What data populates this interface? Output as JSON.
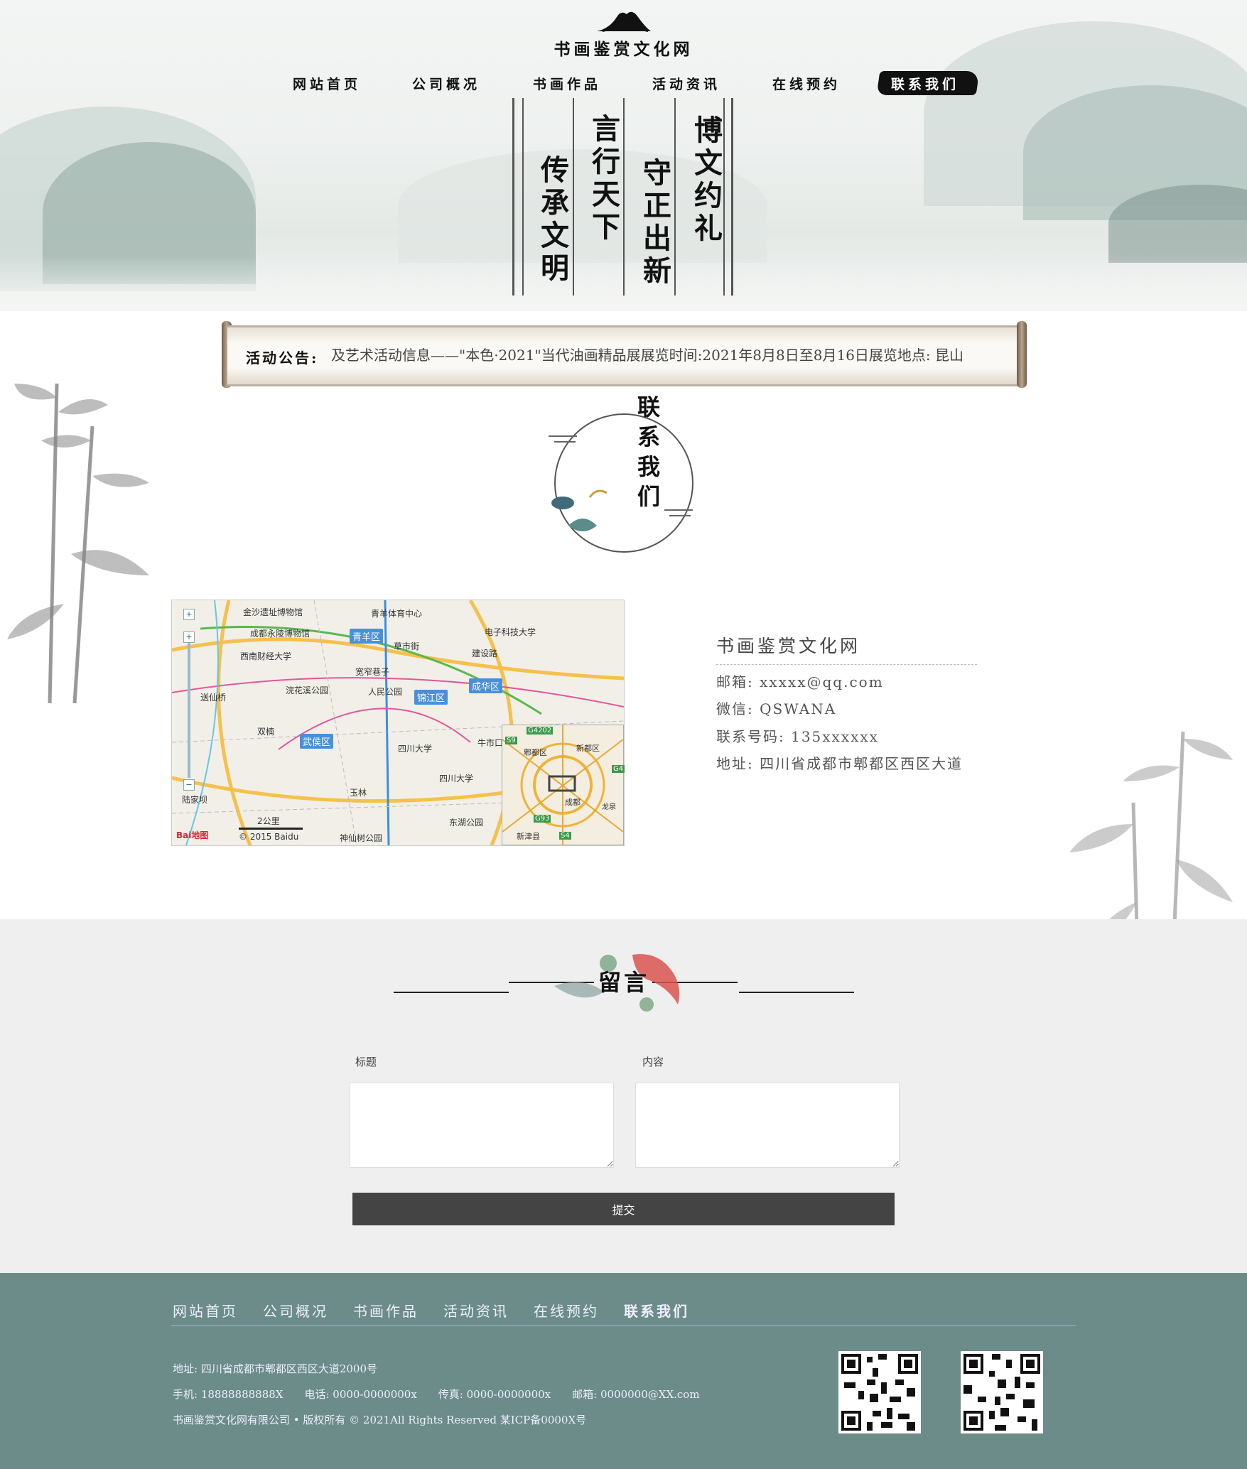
{
  "header": {
    "site_title": "书画鉴赏文化网",
    "nav": [
      "网站首页",
      "公司概况",
      "书画作品",
      "活动资讯",
      "在线预约",
      "联系我们"
    ],
    "active_nav": "联系我们",
    "banner_columns": [
      "传承文明",
      "言行天下",
      "守正出新",
      "博文约礼"
    ]
  },
  "notice": {
    "label": "活动公告:",
    "text": "及艺术活动信息——\"本色·2021\"当代油画精品展展览时间:2021年8月8日至8月16日展览地点: 昆山"
  },
  "contact": {
    "title": "联系我们",
    "company": "书画鉴赏文化网",
    "lines": [
      "邮箱: xxxxx@qq.com",
      "微信: QSWANA",
      "联系号码: 135xxxxxx",
      "地址: 四川省成都市郫都区西区大道"
    ]
  },
  "map": {
    "labels": [
      "金沙遗址博物馆",
      "青羊体育中心",
      "电子科技大学",
      "成都永陵博物馆",
      "草市街",
      "建设路",
      "西南财经大学",
      "宽窄巷子",
      "浣花溪公园",
      "人民公园",
      "锦江区",
      "成华区",
      "送仙桥",
      "双楠",
      "四川大学",
      "牛市口",
      "四川大学",
      "玉林",
      "东湖公园",
      "神仙树公园",
      "陆家坝",
      "青羊区",
      "武侯区"
    ],
    "districts": [
      "青羊区",
      "锦江区",
      "成华区",
      "武侯区"
    ],
    "scale": "2公里",
    "copyright": "© 2015 Baidu",
    "brand": "Bai地图",
    "minimap_labels": [
      "G4202",
      "郫都区",
      "新都区",
      "成都",
      "龙泉",
      "G93",
      "新津县",
      "S9",
      "G4",
      "S4"
    ]
  },
  "message": {
    "title": "留言",
    "subject_label": "标题",
    "content_label": "内容",
    "submit_label": "提交"
  },
  "footer": {
    "nav": [
      "网站首页",
      "公司概况",
      "书画作品",
      "活动资讯",
      "在线预约",
      "联系我们"
    ],
    "address": "地址: 四川省成都市郫都区西区大道2000号",
    "contacts": "手机: 18888888888X　　电话: 0000-0000000x　　传真: 0000-0000000x　　邮箱: 0000000@XX.com",
    "copyright": "书画鉴赏文化网有限公司 • 版权所有 © 2021All Rights Reserved 某ICP备0000X号"
  },
  "colors": {
    "footer_bg": "#6b8c88",
    "message_bg": "#efefef",
    "submit_bg": "#444444",
    "accent_dark": "#111111"
  }
}
